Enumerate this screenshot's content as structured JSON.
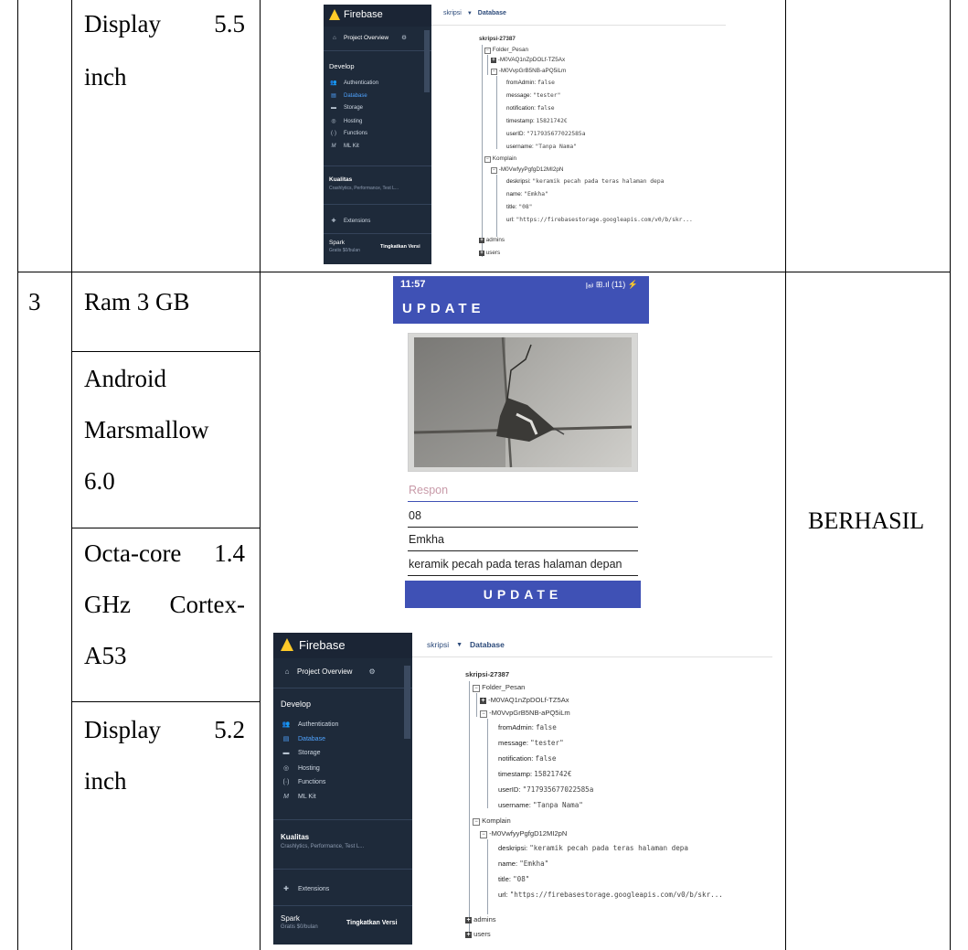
{
  "table": {
    "row_top": {
      "spec_display": {
        "word": "Display",
        "value": "5.5",
        "unit": "inch"
      }
    },
    "row_3": {
      "number": "3",
      "spec_ram": "Ram 3 GB",
      "spec_android": {
        "line1": "Android",
        "line2": "Marsmallow",
        "line3": "6.0"
      },
      "spec_cpu": {
        "word": "Octa-core",
        "value": "1.4",
        "line2_a": "GHz",
        "line2_b": "Cortex-",
        "line3": "A53"
      },
      "spec_display": {
        "word": "Display",
        "value": "5.2",
        "unit": "inch"
      },
      "result": "BERHASIL"
    }
  },
  "firebase": {
    "brand": "Firebase",
    "project_overview": "Project Overview",
    "develop": "Develop",
    "nav": [
      {
        "label": "Authentication",
        "icon": "people-icon"
      },
      {
        "label": "Database",
        "icon": "database-icon"
      },
      {
        "label": "Storage",
        "icon": "folder-icon"
      },
      {
        "label": "Hosting",
        "icon": "hosting-icon"
      },
      {
        "label": "Functions",
        "icon": "functions-icon"
      },
      {
        "label": "ML Kit",
        "icon": "mlkit-icon"
      }
    ],
    "kualitas": "Kualitas",
    "kualitas_sub": "Crashlytics, Performance, Test L...",
    "extensions": "Extensions",
    "plan": "Spark",
    "plan_sub": "Gratis $0/bulan",
    "upgrade": "Tingkatkan Versi",
    "breadcrumb_project": "skripsi",
    "breadcrumb_page": "Database",
    "tree": {
      "root": "skripsi-27387",
      "folder_pesan": "Folder_Pesan",
      "child_a": "-M0VAQ1nZpDOLf-TZ5Ax",
      "child_b": "-M0VvpGrB5NB-aPQ5iLm",
      "fields_b": [
        {
          "key": "fromAdmin:",
          "val": "false"
        },
        {
          "key": "message:",
          "val": "\"tester\""
        },
        {
          "key": "notification:",
          "val": "false"
        },
        {
          "key": "timestamp:",
          "val": "15821742€"
        },
        {
          "key": "userID:",
          "val": "\"717935677022585a"
        },
        {
          "key": "username:",
          "val": "\"Tanpa Nama\""
        }
      ],
      "komplain": "Komplain",
      "komplain_child": "-M0VwfyyPgfgD12MI2pN",
      "fields_k": [
        {
          "key": "deskripsi:",
          "val": "\"keramik pecah pada teras halaman depa"
        },
        {
          "key": "name:",
          "val": "\"Emkha\""
        },
        {
          "key": "title:",
          "val": "\"08\""
        },
        {
          "key": "url:",
          "val": "\"https://firebasestorage.googleapis.com/v0/b/skr..."
        }
      ],
      "admins": "admins",
      "users": "users"
    }
  },
  "phone": {
    "time": "11:57",
    "status_icons": "ꞁₐᵢₗ ⊞.ıl (11) ⚡",
    "title": "UPDATE",
    "respon_placeholder": "Respon",
    "title_value": "08",
    "name_value": "Emkha",
    "desc_value": "keramik pecah pada teras halaman depan",
    "button": "UPDATE"
  }
}
